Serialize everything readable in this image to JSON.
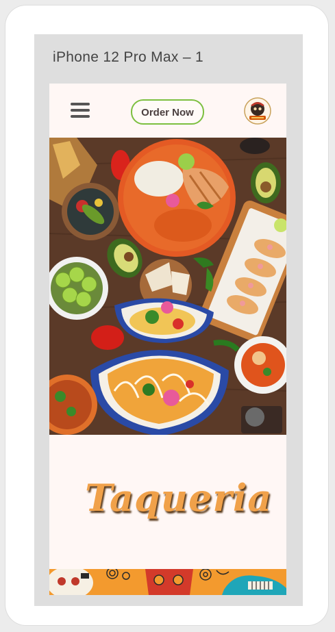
{
  "frame": {
    "title": "iPhone 12 Pro Max – 1"
  },
  "header": {
    "menu_icon": "hamburger-menu-icon",
    "order_button_label": "Order Now",
    "logo_icon": "restaurant-logo"
  },
  "hero": {
    "image": "mexican-food-spread-photo"
  },
  "brand": {
    "title": "Taqueria"
  },
  "footer_pattern": {
    "image": "sugar-skull-pattern"
  },
  "colors": {
    "page_bg": "#fff7f5",
    "order_button_border": "#7cbf3f",
    "brand_text": "#f0a14a",
    "pattern_bg": "#f39a2e"
  }
}
